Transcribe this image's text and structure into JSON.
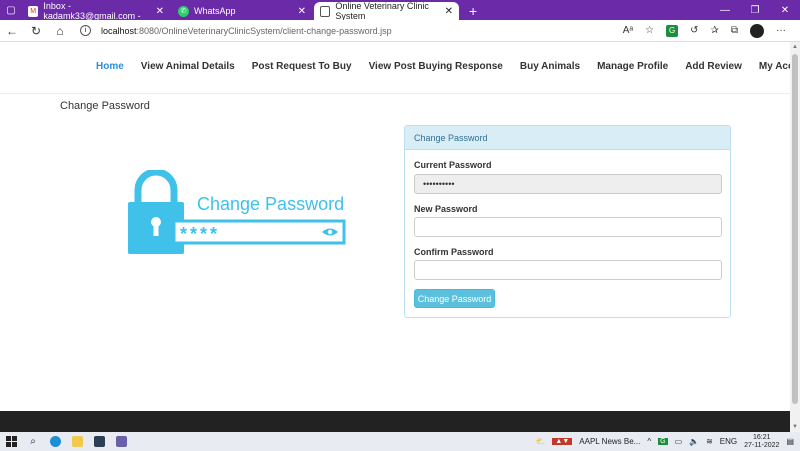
{
  "browser": {
    "tabs": [
      {
        "label": "Inbox - kadamk33@gmail.com -",
        "icon": "gmail-icon",
        "active": false
      },
      {
        "label": "WhatsApp",
        "icon": "whatsapp-icon",
        "active": false
      },
      {
        "label": "Online Veterinary Clinic System",
        "icon": "page-icon",
        "active": true
      }
    ],
    "url_host": "localhost",
    "url_path": ":8080/OnlineVeterinaryClinicSystem/client-change-password.jsp"
  },
  "nav": {
    "items": [
      "Home",
      "View Animal Details",
      "Post Request To Buy",
      "View Post Buying Response",
      "Buy Animals",
      "Manage Profile",
      "Add Review",
      "My Account"
    ]
  },
  "page": {
    "title": "Change Password"
  },
  "illustration": {
    "heading": "Change Password",
    "mask": "****",
    "color": "#3fc1ea"
  },
  "form": {
    "panel_title": "Change Password",
    "current_label": "Current Password",
    "current_value": "••••••••••",
    "new_label": "New Password",
    "new_value": "",
    "confirm_label": "Confirm Password",
    "confirm_value": "",
    "submit_label": "Change Password"
  },
  "taskbar": {
    "news": "AAPL  News Be...",
    "lang": "ENG",
    "time": "16:21",
    "date": "27-11-2022"
  }
}
